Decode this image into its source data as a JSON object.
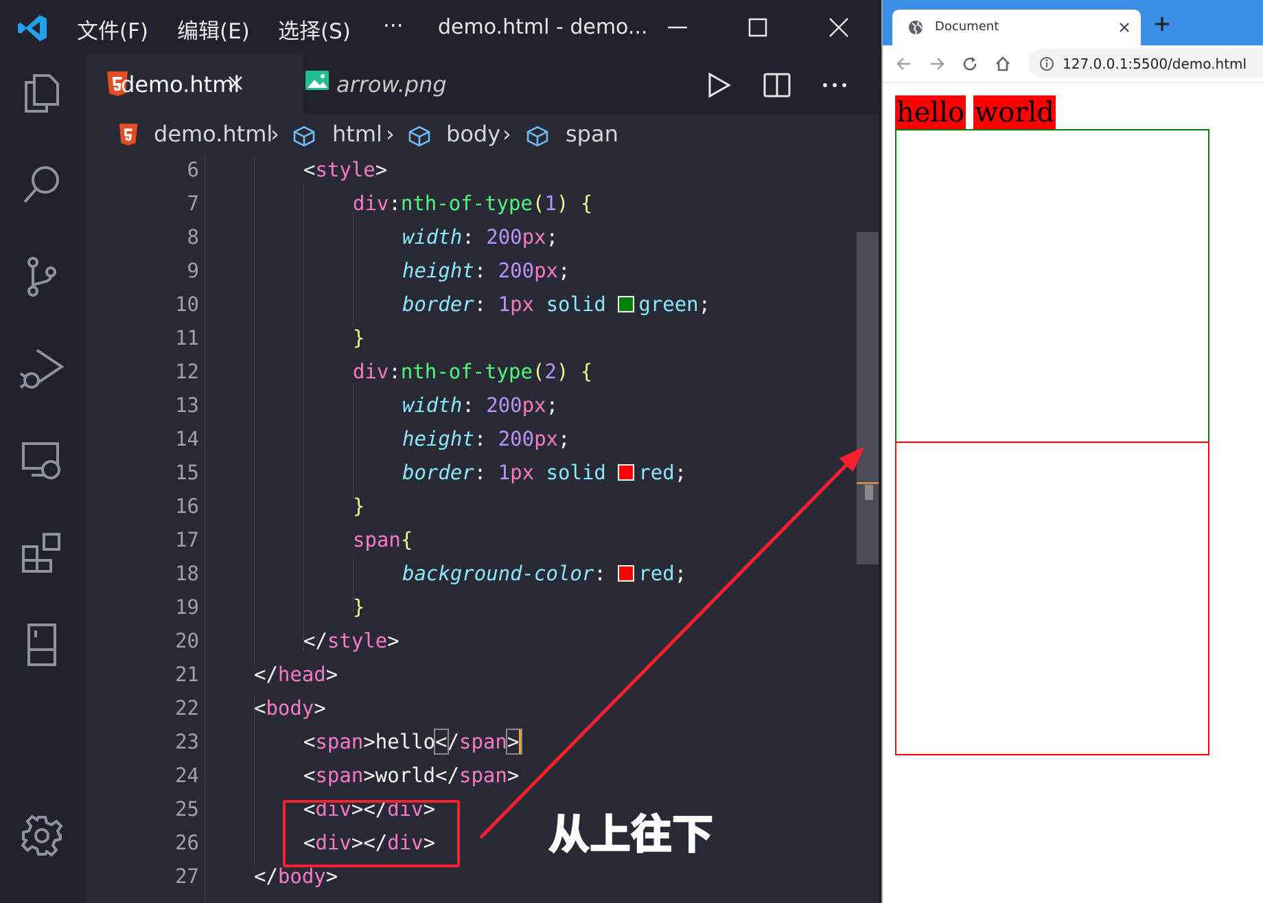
{
  "vscode": {
    "menu": [
      "文件(F)",
      "编辑(E)",
      "选择(S)",
      "···"
    ],
    "window_title": "demo.html - demo...",
    "tabs": [
      {
        "label": "demo.html",
        "active": true
      },
      {
        "label": "arrow.png",
        "active": false
      }
    ],
    "breadcrumb": [
      "demo.html",
      "html",
      "body",
      "span"
    ],
    "line_numbers": [
      "6",
      "7",
      "8",
      "9",
      "10",
      "11",
      "12",
      "13",
      "14",
      "15",
      "16",
      "17",
      "18",
      "19",
      "20",
      "21",
      "22",
      "23",
      "24",
      "25",
      "26",
      "27"
    ],
    "annotation": "从上往下",
    "colors": {
      "green_swatch": "#008000",
      "red_swatch": "#ff0000",
      "highlight_box": "#ff1f2e"
    }
  },
  "browser": {
    "tab_title": "Document",
    "url": "127.0.0.1:5500/demo.html",
    "spans": [
      "hello",
      "world"
    ],
    "box_colors": [
      "#008000",
      "#ff0000"
    ]
  }
}
